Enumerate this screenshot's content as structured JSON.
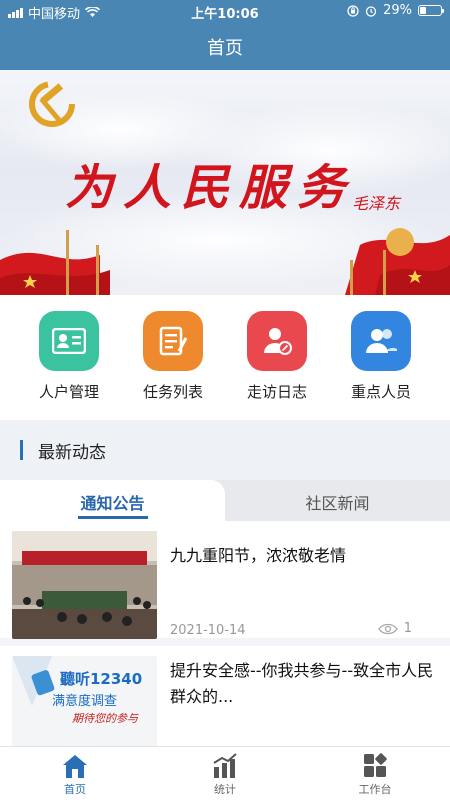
{
  "status_bar": {
    "carrier": "中国移动",
    "time": "上午10:06",
    "battery": "29%",
    "battery_level": 0.29
  },
  "nav": {
    "title": "首页"
  },
  "banner": {
    "calligraphy": "为人民服务",
    "signature": "毛泽东"
  },
  "menu": [
    {
      "label": "人户管理",
      "icon": "id-card-icon",
      "color": "#3bc3a0"
    },
    {
      "label": "任务列表",
      "icon": "task-list-icon",
      "color": "#ee8a2d"
    },
    {
      "label": "走访日志",
      "icon": "visit-log-icon",
      "color": "#e9484f"
    },
    {
      "label": "重点人员",
      "icon": "people-icon",
      "color": "#3386e0"
    }
  ],
  "section": {
    "title": "最新动态"
  },
  "tabs": [
    {
      "label": "通知公告",
      "active": true
    },
    {
      "label": "社区新闻",
      "active": false
    }
  ],
  "news": [
    {
      "title": "九九重阳节，浓浓敬老情",
      "date": "2021-10-14",
      "views": "1"
    },
    {
      "title": "提升安全感--你我共参与--致全市人民群众的...",
      "thumb_text_1": "聽听12340",
      "thumb_text_2": "满意度调查",
      "thumb_text_3": "期待您的参与"
    }
  ],
  "tabbar": [
    {
      "label": "首页",
      "icon": "home-icon",
      "active": true
    },
    {
      "label": "统计",
      "icon": "stats-icon",
      "active": false
    },
    {
      "label": "工作台",
      "icon": "workbench-icon",
      "active": false
    }
  ],
  "colors": {
    "primary": "#4a86b3",
    "accent": "#2a67ad",
    "banner_red": "#d2141d"
  }
}
